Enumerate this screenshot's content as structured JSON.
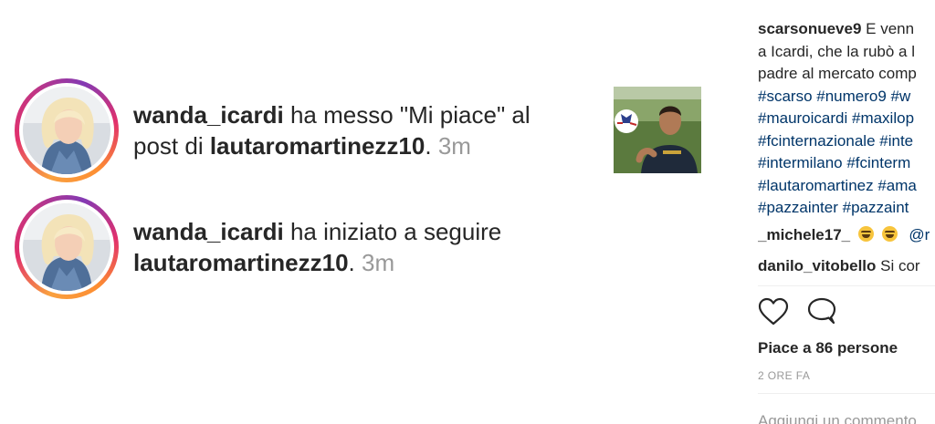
{
  "activity": [
    {
      "username": "wanda_icardi",
      "action": " ha messo \"Mi piace\" al post di ",
      "target": "lautaromartinezz10",
      "time": "3m",
      "icon": "avatar-photo"
    },
    {
      "username": "wanda_icardi",
      "action": " ha iniziato a seguire ",
      "target": "lautaromartinezz10",
      "time": "3m",
      "icon": "avatar-photo"
    }
  ],
  "post": {
    "caption_user": "scarsonueve9",
    "caption_line1": "E venn",
    "caption_line2": "a Icardi, che la rubò a l",
    "caption_line3": "padre al mercato comp",
    "hashtag_lines": [
      "#scarso #numero9 #w",
      "#mauroicardi #maxilop",
      "#fcinternazionale #inte",
      "#intermilano #fcinterm",
      "#lautaromartinez #ama",
      "#pazzainter #pazzaint"
    ],
    "comments": [
      {
        "user": "_michele17_",
        "text": "@r"
      },
      {
        "user": "danilo_vitobello",
        "text": "Si cor"
      }
    ],
    "likes": "Piace a 86 persone",
    "timestamp": "2 ORE FA",
    "add_comment_placeholder": "Aggiungi un commento..."
  },
  "colors": {
    "link": "#003569",
    "muted": "#999999",
    "text": "#262626"
  }
}
